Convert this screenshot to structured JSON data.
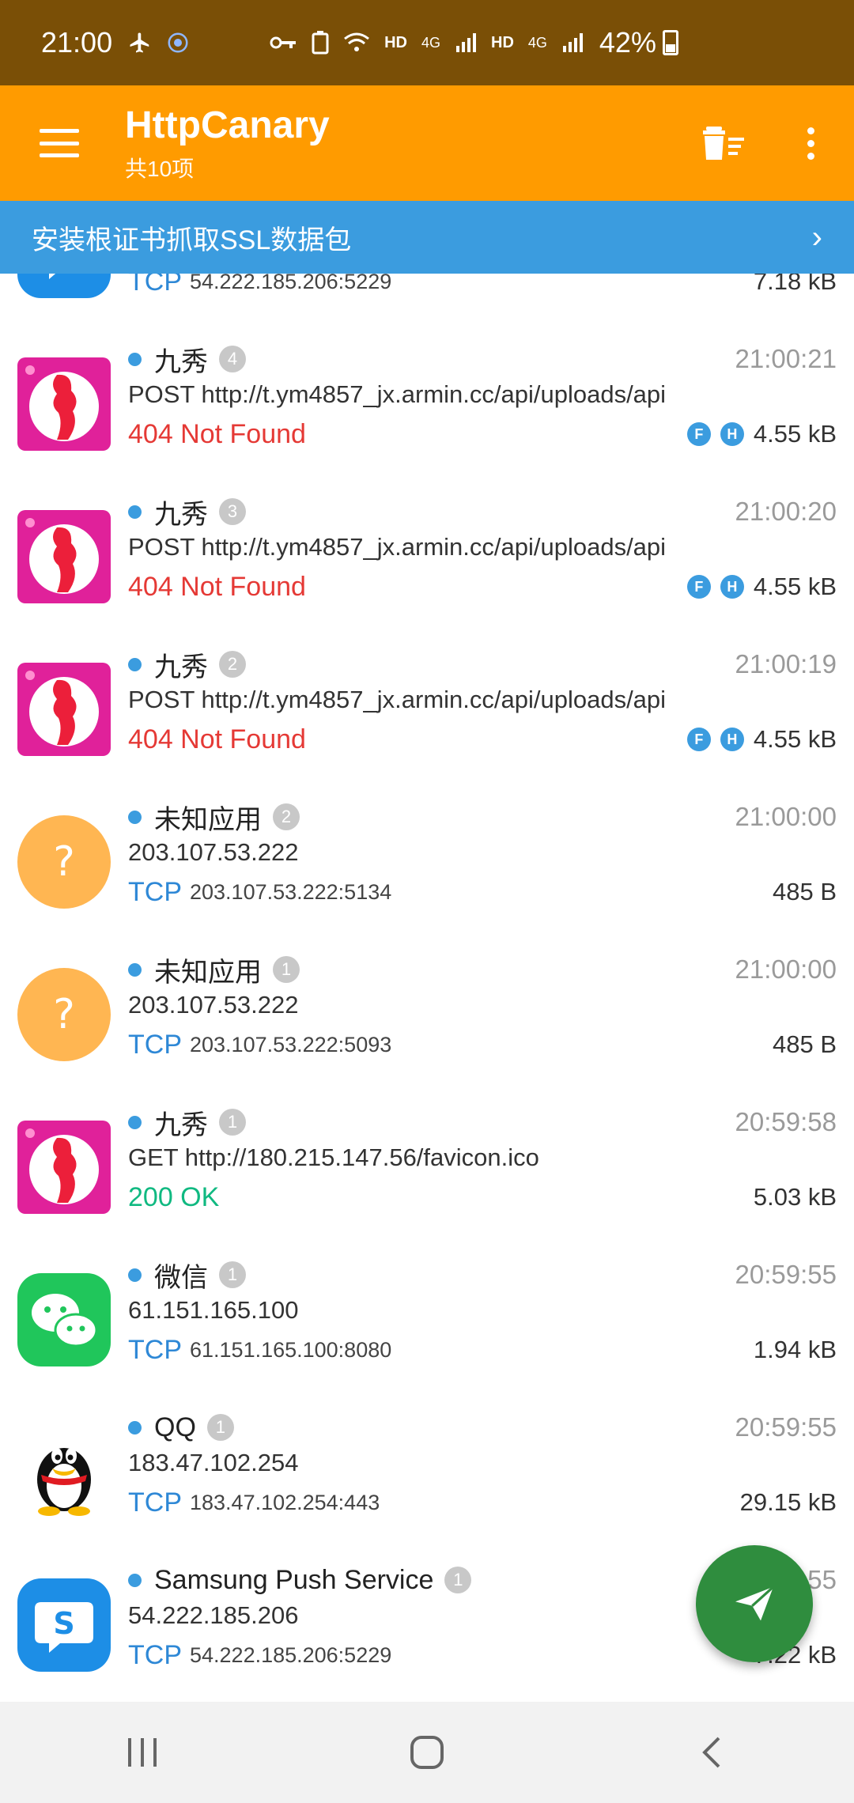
{
  "status_bar": {
    "time": "21:00",
    "network_hd1": "HD",
    "network_4g1": "4G",
    "network_hd2": "HD",
    "network_4g2": "4G",
    "battery": "42%"
  },
  "app_bar": {
    "title": "HttpCanary",
    "subtitle": "共10项"
  },
  "banner": {
    "text": "安装根证书抓取SSL数据包"
  },
  "rows": [
    {
      "proto": "TCP",
      "addr": "54.222.185.206:5229",
      "size": "7.18 kB"
    },
    {
      "app": "九秀",
      "badge": "4",
      "time": "21:00:21",
      "line2": "POST http://t.ym4857_jx.armin.cc/api/uploads/api",
      "status": "404 Not Found",
      "flag1": "F",
      "flag2": "H",
      "size": "4.55 kB"
    },
    {
      "app": "九秀",
      "badge": "3",
      "time": "21:00:20",
      "line2": "POST http://t.ym4857_jx.armin.cc/api/uploads/api",
      "status": "404 Not Found",
      "flag1": "F",
      "flag2": "H",
      "size": "4.55 kB"
    },
    {
      "app": "九秀",
      "badge": "2",
      "time": "21:00:19",
      "line2": "POST http://t.ym4857_jx.armin.cc/api/uploads/api",
      "status": "404 Not Found",
      "flag1": "F",
      "flag2": "H",
      "size": "4.55 kB"
    },
    {
      "app": "未知应用",
      "badge": "2",
      "time": "21:00:00",
      "line2": "203.107.53.222",
      "proto": "TCP",
      "addr": "203.107.53.222:5134",
      "size": "485 B"
    },
    {
      "app": "未知应用",
      "badge": "1",
      "time": "21:00:00",
      "line2": "203.107.53.222",
      "proto": "TCP",
      "addr": "203.107.53.222:5093",
      "size": "485 B"
    },
    {
      "app": "九秀",
      "badge": "1",
      "time": "20:59:58",
      "line2": "GET http://180.215.147.56/favicon.ico",
      "status": "200 OK",
      "size": "5.03 kB"
    },
    {
      "app": "微信",
      "badge": "1",
      "time": "20:59:55",
      "line2": "61.151.165.100",
      "proto": "TCP",
      "addr": "61.151.165.100:8080",
      "size": "1.94 kB"
    },
    {
      "app": "QQ",
      "badge": "1",
      "time": "20:59:55",
      "line2": "183.47.102.254",
      "proto": "TCP",
      "addr": "183.47.102.254:443",
      "size": "29.15 kB"
    },
    {
      "app": "Samsung Push Service",
      "badge": "1",
      "time": "20:59:55",
      "line2": "54.222.185.206",
      "proto": "TCP",
      "addr": "54.222.185.206:5229",
      "size": "7.22 kB"
    }
  ],
  "colors": {
    "status_bar": "#7a4f06",
    "app_bar": "#ff9b00",
    "banner": "#3b9cdf",
    "error": "#e53935",
    "ok": "#10b981",
    "tcp": "#2e88d6",
    "fab": "#2f8d3e"
  },
  "icons": {
    "menu": "hamburger-icon",
    "clear": "clear-list-icon",
    "more": "more-vert-icon",
    "fab": "send-icon"
  }
}
